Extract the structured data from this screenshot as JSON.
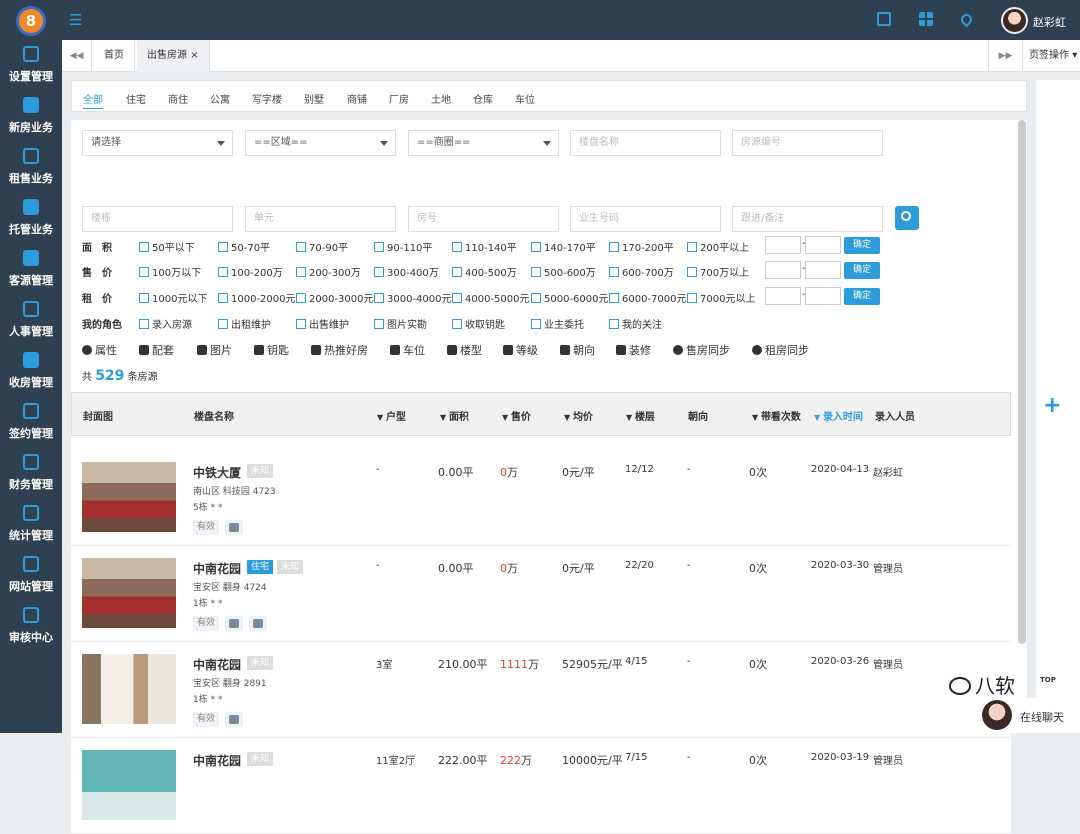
{
  "app": {
    "logo_text": "8",
    "user_name": "赵彩虹"
  },
  "tabs": {
    "home": "首页",
    "active": "出售房源",
    "close": "×",
    "right_menu": "页签操作"
  },
  "sidebar": {
    "items": [
      {
        "label": "设置管理",
        "icon": "gear-icon"
      },
      {
        "label": "新房业务",
        "icon": "building-icon"
      },
      {
        "label": "租售业务",
        "icon": "home-icon"
      },
      {
        "label": "托管业务",
        "icon": "hand-house-icon"
      },
      {
        "label": "客源管理",
        "icon": "users-icon"
      },
      {
        "label": "人事管理",
        "icon": "org-chart-icon"
      },
      {
        "label": "收房管理",
        "icon": "office-icon"
      },
      {
        "label": "签约管理",
        "icon": "contract-icon"
      },
      {
        "label": "财务管理",
        "icon": "wallet-icon"
      },
      {
        "label": "统计管理",
        "icon": "bar-chart-icon"
      },
      {
        "label": "网站管理",
        "icon": "monitor-icon"
      },
      {
        "label": "审核中心",
        "icon": "check-doc-icon"
      }
    ]
  },
  "type_tabs": [
    "全部",
    "住宅",
    "商住",
    "公寓",
    "写字楼",
    "别墅",
    "商铺",
    "厂房",
    "土地",
    "仓库",
    "车位"
  ],
  "filters": {
    "select1": "请选择",
    "select2": "==区域==",
    "select3": "==商圈==",
    "ph_building": "楼盘名称",
    "ph_house_no": "房源编号",
    "ph_block": "楼栋",
    "ph_unit": "单元",
    "ph_room": "房号",
    "ph_owner_phone": "业主号码",
    "ph_follow": "跟进/备注",
    "area_label": "面　积",
    "area_opts": [
      "50平以下",
      "50-70平",
      "70-90平",
      "90-110平",
      "110-140平",
      "140-170平",
      "170-200平",
      "200平以上"
    ],
    "price_label": "售　价",
    "price_opts": [
      "100万以下",
      "100-200万",
      "200-300万",
      "300-400万",
      "400-500万",
      "500-600万",
      "600-700万",
      "700万以上"
    ],
    "rent_label": "租　价",
    "rent_opts": [
      "1000元以下",
      "1000-2000元",
      "2000-3000元",
      "3000-4000元",
      "4000-5000元",
      "5000-6000元",
      "6000-7000元",
      "7000元以上"
    ],
    "role_label": "我的角色",
    "role_opts": [
      "录入房源",
      "出租维护",
      "出售维护",
      "图片实勘",
      "收取钥匙",
      "业主委托",
      "我的关注"
    ],
    "confirm": "确定",
    "range_dash": "-"
  },
  "features": [
    "属性",
    "配套",
    "图片",
    "钥匙",
    "热推好房",
    "车位",
    "楼型",
    "等级",
    "朝向",
    "装修",
    "售房同步",
    "租房同步"
  ],
  "count": {
    "prefix": "共",
    "value": "529",
    "suffix": "条房源"
  },
  "table": {
    "headers": [
      "封面图",
      "楼盘名称",
      "户型",
      "面积",
      "售价",
      "均价",
      "楼层",
      "朝向",
      "带看次数",
      "录入时间",
      "录入人员"
    ],
    "rows": [
      {
        "name": "中铁大厦",
        "tags": [
          "未知"
        ],
        "addr": "南山区 科技园 4723",
        "unit": "5栋 * *",
        "status": "有效",
        "layout": "-",
        "area": "0.00平",
        "price": "0",
        "price_unit": "万",
        "avg": "0元/平",
        "floor": "12/12",
        "orient": "-",
        "views": "0次",
        "date": "2020-04-13",
        "agent": "赵彩虹"
      },
      {
        "name": "中南花园",
        "tags": [
          "住宅",
          "未知"
        ],
        "addr": "宝安区 翻身 4724",
        "unit": "1栋 * *",
        "status": "有效",
        "layout": "-",
        "area": "0.00平",
        "price": "0",
        "price_unit": "万",
        "avg": "0元/平",
        "floor": "22/20",
        "orient": "-",
        "views": "0次",
        "date": "2020-03-30",
        "agent": "管理员"
      },
      {
        "name": "中南花园",
        "tags": [
          "未知"
        ],
        "addr": "宝安区 翻身 2891",
        "unit": "1栋 * *",
        "status": "有效",
        "layout": "3室",
        "area": "210.00平",
        "price": "1111",
        "price_unit": "万",
        "avg": "52905元/平",
        "floor": "4/15",
        "orient": "-",
        "views": "0次",
        "date": "2020-03-26",
        "agent": "管理员"
      },
      {
        "name": "中南花园",
        "tags": [
          "未知"
        ],
        "addr": "",
        "unit": "",
        "status": "",
        "layout": "11室2厅",
        "area": "222.00平",
        "price": "222",
        "price_unit": "万",
        "avg": "10000元/平",
        "floor": "7/15",
        "orient": "-",
        "views": "0次",
        "date": "2020-03-19",
        "agent": "管理员"
      }
    ]
  },
  "watermark": "八软",
  "to_top": "TOP",
  "chat": {
    "label": "在线聊天"
  },
  "colors": {
    "sidebar": "#2f4050",
    "accent": "#2d9cdb",
    "price_red": "#e43d30"
  }
}
